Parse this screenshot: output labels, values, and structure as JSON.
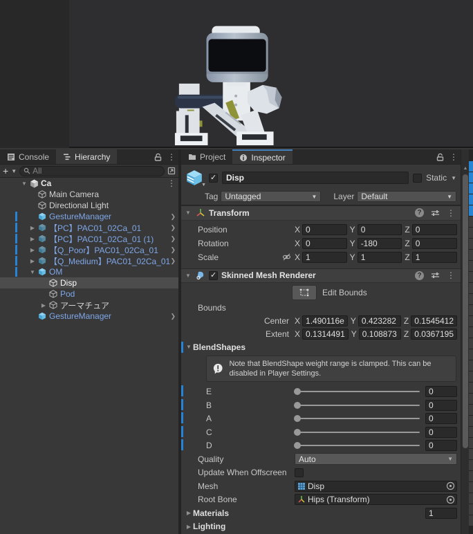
{
  "colors": {
    "accent_blue": "#2584d4",
    "prefab_text": "#7fa7e8",
    "selection": "#4c4c4c",
    "panel_bg": "#383838"
  },
  "left_panel": {
    "tabs": [
      {
        "label": "Console"
      },
      {
        "label": "Hierarchy"
      }
    ],
    "toolbar": {
      "plus": "+",
      "search_placeholder": "All"
    },
    "tree": [
      {
        "label": "Ca"
      },
      {
        "label": "Main Camera"
      },
      {
        "label": "Directional Light"
      },
      {
        "label": "GestureManager"
      },
      {
        "label": "【PC】PAC01_02Ca_01"
      },
      {
        "label": "【PC】PAC01_02Ca_01 (1)"
      },
      {
        "label": "【Q_Poor】PAC01_02Ca_01"
      },
      {
        "label": "【Q_Medium】PAC01_02Ca_01"
      },
      {
        "label": "OM"
      },
      {
        "label": "Disp"
      },
      {
        "label": "Pod"
      },
      {
        "label": "アーマチュア"
      },
      {
        "label": "GestureManager"
      }
    ]
  },
  "right_panel": {
    "tabs": [
      {
        "label": "Project"
      },
      {
        "label": "Inspector"
      }
    ],
    "axis": {
      "x": "X",
      "y": "Y",
      "z": "Z"
    },
    "header": {
      "name": "Disp",
      "static_label": "Static",
      "tag_label": "Tag",
      "tag_value": "Untagged",
      "layer_label": "Layer",
      "layer_value": "Default"
    },
    "transform": {
      "title": "Transform",
      "rows": [
        {
          "label": "Position",
          "x": "0",
          "y": "0",
          "z": "0"
        },
        {
          "label": "Rotation",
          "x": "0",
          "y": "-180",
          "z": "0"
        },
        {
          "label": "Scale",
          "x": "1",
          "y": "1",
          "z": "1"
        }
      ]
    },
    "smr": {
      "title": "Skinned Mesh Renderer",
      "edit_bounds_label": "Edit Bounds",
      "bounds_label": "Bounds",
      "center": {
        "label": "Center",
        "x": "1.490116e",
        "y": "0.423282",
        "z": "0.1545412"
      },
      "extent": {
        "label": "Extent",
        "x": "0.1314491",
        "y": "0.108873",
        "z": "0.0367195"
      },
      "blendshapes": {
        "title": "BlendShapes",
        "note": "Note that BlendShape weight range is clamped. This can be disabled in Player Settings.",
        "sliders": [
          {
            "label": "E",
            "value": "0"
          },
          {
            "label": "B",
            "value": "0"
          },
          {
            "label": "A",
            "value": "0"
          },
          {
            "label": "C",
            "value": "0"
          },
          {
            "label": "D",
            "value": "0"
          }
        ]
      },
      "quality_label": "Quality",
      "quality_value": "Auto",
      "offscreen_label": "Update When Offscreen",
      "mesh_label": "Mesh",
      "mesh_value": "Disp",
      "rootbone_label": "Root Bone",
      "rootbone_value": "Hips (Transform)",
      "materials_label": "Materials",
      "materials_count": "1",
      "lighting_label": "Lighting"
    }
  }
}
